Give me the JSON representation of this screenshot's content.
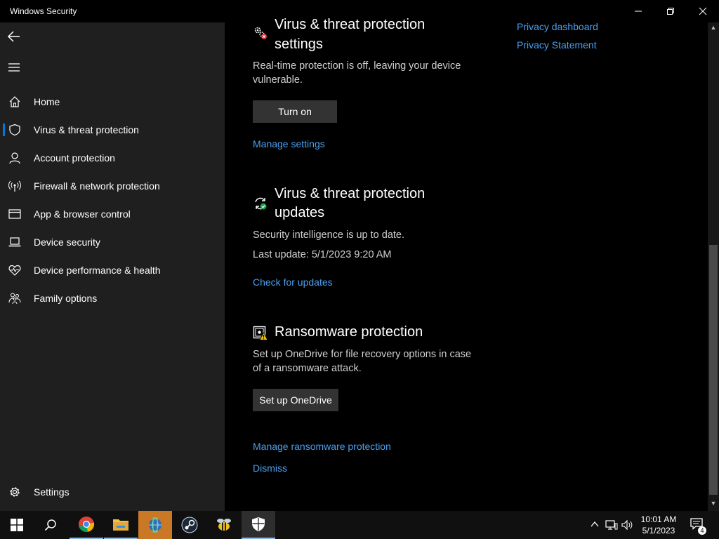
{
  "window": {
    "title": "Windows Security",
    "minimize_icon": "minimize-icon",
    "maximize_icon": "restore-icon",
    "close_icon": "close-icon"
  },
  "sidebar": {
    "back_icon": "back-arrow-icon",
    "menu_icon": "hamburger-icon",
    "items": [
      {
        "label": "Home",
        "icon": "home-icon",
        "active": false
      },
      {
        "label": "Virus & threat protection",
        "icon": "shield-icon",
        "active": true
      },
      {
        "label": "Account protection",
        "icon": "person-icon",
        "active": false
      },
      {
        "label": "Firewall & network protection",
        "icon": "antenna-icon",
        "active": false
      },
      {
        "label": "App & browser control",
        "icon": "browser-window-icon",
        "active": false
      },
      {
        "label": "Device security",
        "icon": "laptop-icon",
        "active": false
      },
      {
        "label": "Device performance & health",
        "icon": "heart-pulse-icon",
        "active": false
      },
      {
        "label": "Family options",
        "icon": "family-icon",
        "active": false
      }
    ],
    "settings_label": "Settings",
    "settings_icon": "gear-icon"
  },
  "main": {
    "settings_section": {
      "title_line1": "Virus & threat protection",
      "title_line2": "settings",
      "text_line1": "Real-time protection is off, leaving your device",
      "text_line2": "vulnerable.",
      "button": "Turn on",
      "link": "Manage settings",
      "icon": "gears-warning-icon"
    },
    "updates_section": {
      "title_line1": "Virus & threat protection",
      "title_line2": "updates",
      "status": "Security intelligence is up to date.",
      "last_update": "Last update: 5/1/2023 9:20 AM",
      "link": "Check for updates",
      "icon": "refresh-check-icon"
    },
    "ransomware_section": {
      "title": "Ransomware protection",
      "text_line1": "Set up OneDrive for file recovery options in case",
      "text_line2": "of a ransomware attack.",
      "button": "Set up OneDrive",
      "link1": "Manage ransomware protection",
      "link2": "Dismiss",
      "icon": "ransomware-warning-icon"
    },
    "right_links": {
      "privacy_dashboard": "Privacy dashboard",
      "privacy_statement": "Privacy Statement"
    }
  },
  "taskbar": {
    "apps": [
      "start-icon",
      "search-icon",
      "chrome-icon",
      "file-explorer-icon",
      "network-app-icon",
      "steam-icon",
      "bee-app-icon",
      "windows-security-icon"
    ],
    "clock_time": "10:01 AM",
    "clock_date": "5/1/2023",
    "notification_count": "4",
    "tray_icons": [
      "chevron-up-icon",
      "network-icon",
      "volume-icon"
    ]
  },
  "colors": {
    "accent": "#0078d7",
    "link": "#4aa0f0",
    "sidebar_bg": "#1f1f1f",
    "main_bg": "#000000",
    "taskbar_bg": "#101010",
    "orange_app": "#c97826"
  }
}
